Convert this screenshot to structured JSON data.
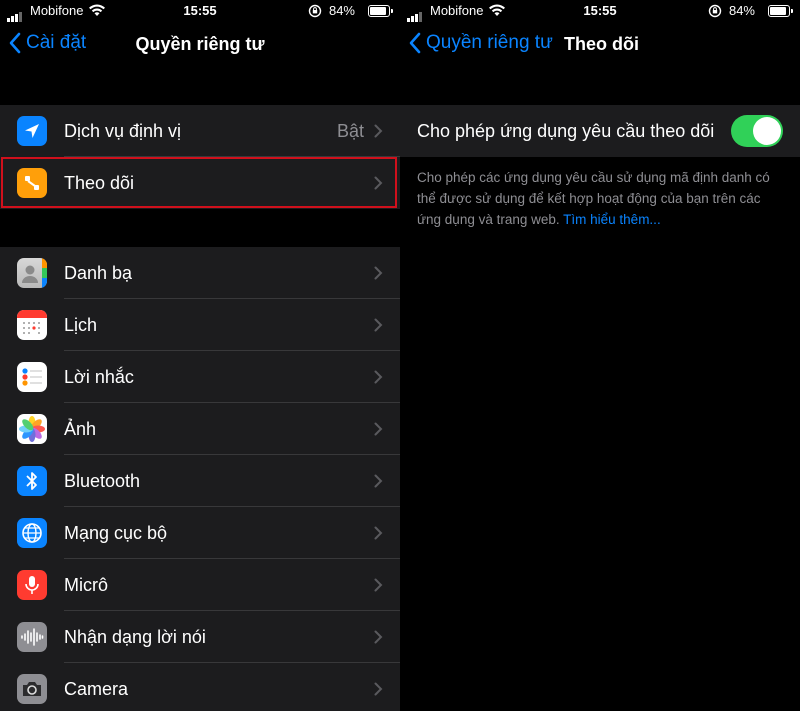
{
  "status": {
    "carrier": "Mobifone",
    "time": "15:55",
    "battery": "84%",
    "battery_level": 0.84
  },
  "left": {
    "back_label": "Cài đặt",
    "title": "Quyền riêng tư",
    "group1": [
      {
        "label": "Dịch vụ định vị",
        "detail": "Bật",
        "icon": "location-arrow-icon",
        "color": "#0a84ff"
      },
      {
        "label": "Theo dõi",
        "detail": "",
        "icon": "tracking-icon",
        "color": "#ff9f0a"
      }
    ],
    "group2": [
      {
        "label": "Danh bạ",
        "icon": "contacts-icon"
      },
      {
        "label": "Lịch",
        "icon": "calendar-icon"
      },
      {
        "label": "Lời nhắc",
        "icon": "reminders-icon"
      },
      {
        "label": "Ảnh",
        "icon": "photos-icon"
      },
      {
        "label": "Bluetooth",
        "icon": "bluetooth-icon",
        "color": "#0a84ff"
      },
      {
        "label": "Mạng cục bộ",
        "icon": "globe-icon",
        "color": "#0a84ff"
      },
      {
        "label": "Micrô",
        "icon": "microphone-icon",
        "color": "#ff3b30"
      },
      {
        "label": "Nhận dạng lời nói",
        "icon": "speech-recognition-icon",
        "color": "#8e8e93"
      },
      {
        "label": "Camera",
        "icon": "camera-icon",
        "color": "#8e8e93"
      }
    ]
  },
  "right": {
    "back_label": "Quyền riêng tư",
    "title": "Theo dõi",
    "toggle_label": "Cho phép ứng dụng yêu cầu theo dõi",
    "toggle_on": true,
    "footnote": "Cho phép các ứng dụng yêu cầu sử dụng mã định danh có thể được sử dụng để kết hợp hoạt động của bạn trên các ứng dụng và trang web.",
    "learn_more": "Tìm hiểu thêm..."
  },
  "colors": {
    "accent": "#0a84ff",
    "toggle_on": "#30d158",
    "highlight_border": "#d0101c"
  }
}
